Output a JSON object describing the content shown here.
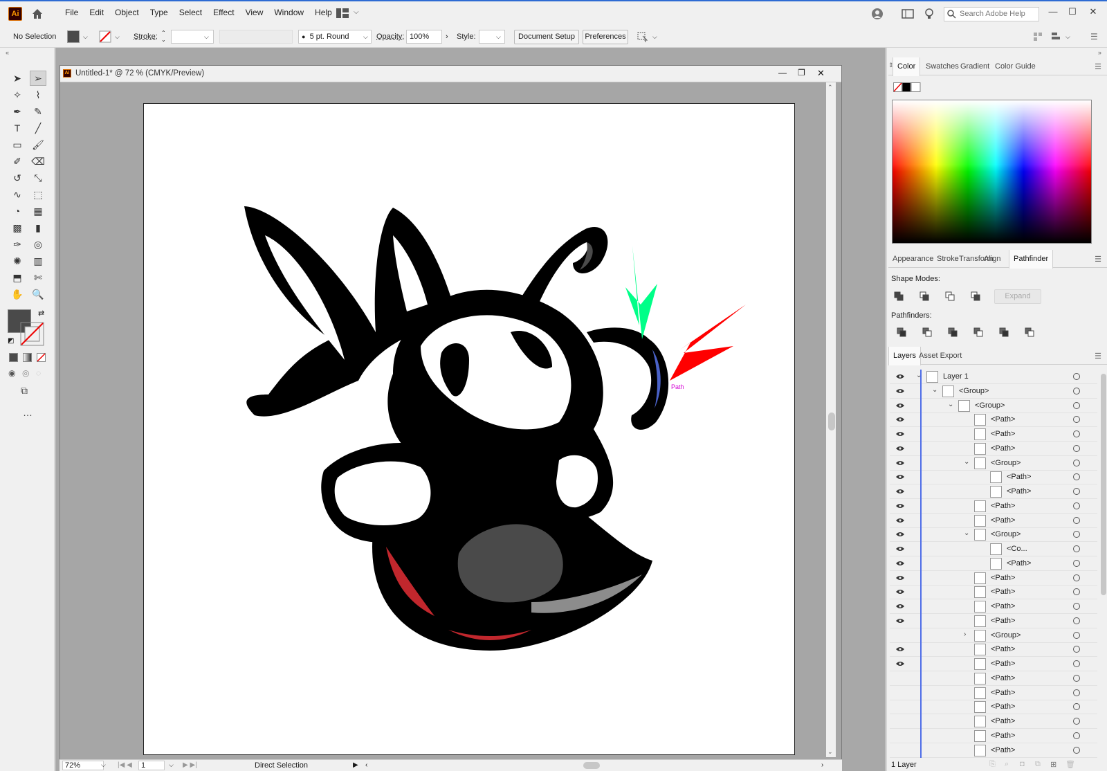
{
  "menubar": {
    "logo": "Ai",
    "menus": [
      "File",
      "Edit",
      "Object",
      "Type",
      "Select",
      "Effect",
      "View",
      "Window",
      "Help"
    ],
    "search_placeholder": "Search Adobe Help"
  },
  "control_bar": {
    "selection": "No Selection",
    "stroke_label": "Stroke:",
    "brush": "5 pt. Round",
    "opacity_label": "Opacity:",
    "opacity_value": "100%",
    "style_label": "Style:",
    "document_setup": "Document Setup",
    "preferences": "Preferences"
  },
  "document": {
    "title": "Untitled-1* @ 72 % (CMYK/Preview)",
    "path_label": "Path"
  },
  "status": {
    "zoom": "72%",
    "artboard": "1",
    "tool": "Direct Selection"
  },
  "color_panel": {
    "tabs": [
      "Color",
      "Swatches",
      "Gradient",
      "Color Guide"
    ],
    "active": "Color"
  },
  "pathfinder_panel": {
    "tabs": [
      "Appearance",
      "Stroke",
      "Transform",
      "Align",
      "Pathfinder"
    ],
    "active": "Pathfinder",
    "shape_modes": "Shape Modes:",
    "expand": "Expand",
    "pathfinders": "Pathfinders:"
  },
  "layers_panel": {
    "tabs": [
      "Layers",
      "Asset Export"
    ],
    "footer": "1 Layer",
    "rows": [
      {
        "name": "Layer 1",
        "depth": 0,
        "tw": "v",
        "eye": true
      },
      {
        "name": "<Group>",
        "depth": 1,
        "tw": "v",
        "eye": true
      },
      {
        "name": "<Group>",
        "depth": 2,
        "tw": "v",
        "eye": true
      },
      {
        "name": "<Path>",
        "depth": 3,
        "tw": "",
        "eye": true
      },
      {
        "name": "<Path>",
        "depth": 3,
        "tw": "",
        "eye": true
      },
      {
        "name": "<Path>",
        "depth": 3,
        "tw": "",
        "eye": true
      },
      {
        "name": "<Group>",
        "depth": 3,
        "tw": "v",
        "eye": true
      },
      {
        "name": "<Path>",
        "depth": 4,
        "tw": "",
        "eye": true
      },
      {
        "name": "<Path>",
        "depth": 4,
        "tw": "",
        "eye": true
      },
      {
        "name": "<Path>",
        "depth": 3,
        "tw": "",
        "eye": true
      },
      {
        "name": "<Path>",
        "depth": 3,
        "tw": "",
        "eye": true
      },
      {
        "name": "<Group>",
        "depth": 3,
        "tw": "v",
        "eye": true
      },
      {
        "name": "<Co...",
        "depth": 4,
        "tw": "",
        "eye": true
      },
      {
        "name": "<Path>",
        "depth": 4,
        "tw": "",
        "eye": true
      },
      {
        "name": "<Path>",
        "depth": 3,
        "tw": "",
        "eye": true
      },
      {
        "name": "<Path>",
        "depth": 3,
        "tw": "",
        "eye": true
      },
      {
        "name": "<Path>",
        "depth": 3,
        "tw": "",
        "eye": true
      },
      {
        "name": "<Path>",
        "depth": 3,
        "tw": "",
        "eye": true
      },
      {
        "name": "<Group>",
        "depth": 3,
        "tw": ">",
        "eye": false
      },
      {
        "name": "<Path>",
        "depth": 3,
        "tw": "",
        "eye": true
      },
      {
        "name": "<Path>",
        "depth": 3,
        "tw": "",
        "eye": true
      },
      {
        "name": "<Path>",
        "depth": 3,
        "tw": "",
        "eye": false
      },
      {
        "name": "<Path>",
        "depth": 3,
        "tw": "",
        "eye": false
      },
      {
        "name": "<Path>",
        "depth": 3,
        "tw": "",
        "eye": false
      },
      {
        "name": "<Path>",
        "depth": 3,
        "tw": "",
        "eye": false
      },
      {
        "name": "<Path>",
        "depth": 3,
        "tw": "",
        "eye": false
      },
      {
        "name": "<Path>",
        "depth": 3,
        "tw": "",
        "eye": false
      }
    ]
  },
  "colors": {
    "accent": "#4f6ee8",
    "fill": "#4a4a4a",
    "arrow_green": "#00ff88",
    "arrow_red": "#ff0000",
    "hornet_red": "#c1272d"
  }
}
